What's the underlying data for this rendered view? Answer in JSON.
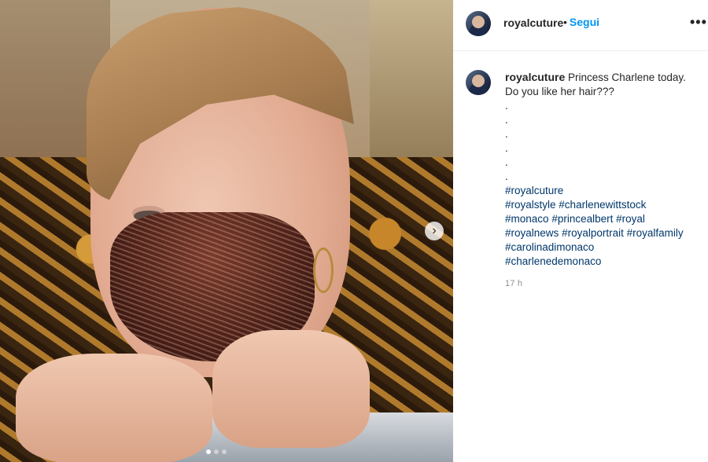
{
  "post": {
    "username": "royalcuture",
    "follow_separator": "•",
    "follow_label": "Segui",
    "more_label": "•••"
  },
  "media": {
    "carousel_dots": 3,
    "active_dot": 0,
    "next_icon": "chevron-right-icon",
    "next_label": "›"
  },
  "caption": {
    "username": "royalcuture",
    "text_line1": "Princess Charlene today.",
    "text_line2": "Do you like her hair???",
    "dots": [
      ".",
      ".",
      ".",
      ".",
      ".",
      "."
    ],
    "hashtags": [
      [
        "#royalcuture"
      ],
      [
        "#royalstyle",
        "#charlenewittstock"
      ],
      [
        "#monaco",
        "#princealbert",
        "#royal"
      ],
      [
        "#royalnews",
        "#royalportrait",
        "#royalfamily"
      ],
      [
        "#carolinadimonaco"
      ],
      [
        "#charlenedemonaco"
      ]
    ],
    "time": "17 h"
  },
  "colors": {
    "link_blue": "#0095f6",
    "hashtag": "#00376b",
    "muted": "#8e8e8e"
  }
}
